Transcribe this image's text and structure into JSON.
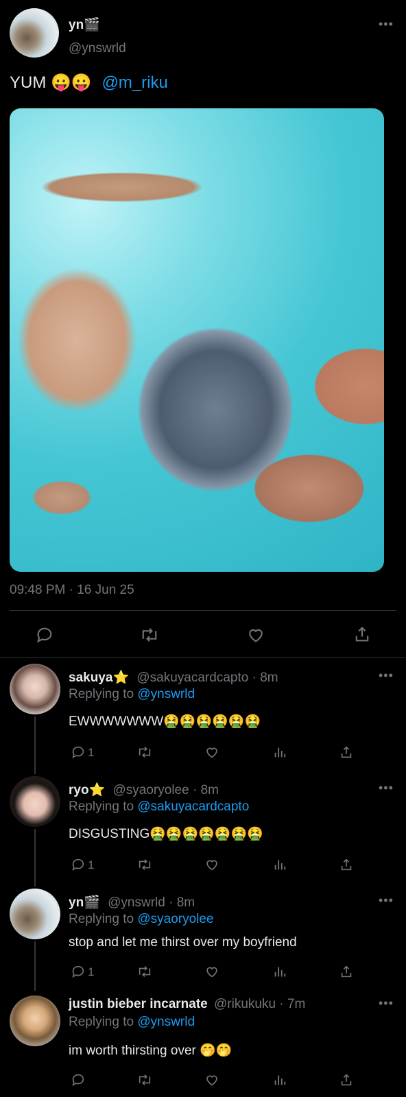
{
  "main_tweet": {
    "display_name": "yn🎬",
    "handle": "@ynswrld",
    "text_prefix": "YUM 😛😛",
    "mention": "@m_riku",
    "timestamp": "09:48 PM · 16 Jun 25"
  },
  "replies": [
    {
      "display_name": "sakuya⭐",
      "handle_time": "@sakuyacardcapto · 8m",
      "replying_label": "Replying to",
      "replying_to": "@ynswrld",
      "text": "EWWWWWWW🤮🤮🤮🤮🤮🤮",
      "reply_count": "1"
    },
    {
      "display_name": "ryo⭐",
      "handle_time": "@syaoryolee · 8m",
      "replying_label": "Replying to",
      "replying_to": "@sakuyacardcapto",
      "text": "DISGUSTING🤮🤮🤮🤮🤮🤮🤮",
      "reply_count": "1"
    },
    {
      "display_name": "yn🎬",
      "handle_time": "@ynswrld · 8m",
      "replying_label": "Replying to",
      "replying_to": "@syaoryolee",
      "text": "stop and let me thirst over my boyfriend",
      "reply_count": "1"
    },
    {
      "display_name": "justin bieber incarnate",
      "handle_time": "@rikukuku · 7m",
      "replying_label": "Replying to",
      "replying_to": "@ynswrld",
      "text": "im worth thirsting over 🤭🤭",
      "reply_count": ""
    }
  ],
  "icons": {
    "more": "more-dots-icon",
    "reply": "reply-bubble-icon",
    "retweet": "retweet-icon",
    "like": "heart-icon",
    "views": "views-bars-icon",
    "share": "share-icon"
  },
  "colors": {
    "background": "#000000",
    "text": "#e7e9ea",
    "muted": "#71767b",
    "link": "#1d9bf0",
    "divider": "#2f3336"
  }
}
